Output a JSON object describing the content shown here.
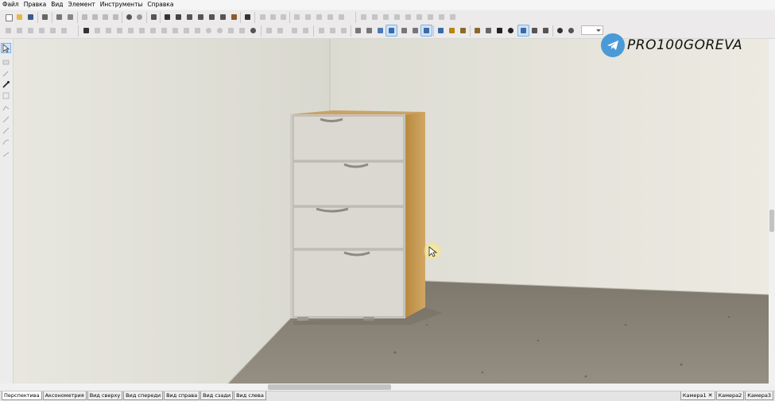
{
  "menu": [
    "Файл",
    "Правка",
    "Вид",
    "Элемент",
    "Инструменты",
    "Справка"
  ],
  "toolbar": {
    "combo_value": ""
  },
  "viewport": {
    "scene": "3d-room-with-drawer-cabinet",
    "colors": {
      "left_wall": "#e3e2da",
      "right_wall": "#e8e6dc",
      "floor": "#8a8478",
      "cabinet_front": "#d9d7cf",
      "cabinet_side": "#c79a55",
      "cursor_highlight": "#ffe66b"
    },
    "drawer_count": 4
  },
  "watermark": {
    "text": "PRO100GOREVA",
    "icon": "telegram-icon"
  },
  "tabs": [
    "Перспектива",
    "Аксонометрия",
    "Вид сверху",
    "Вид спереди",
    "Вид справа",
    "Вид сзади",
    "Вид слева"
  ],
  "active_tab": "Перспектива",
  "camera_tabs": [
    "Камера1",
    "Камера2",
    "Камера3"
  ]
}
